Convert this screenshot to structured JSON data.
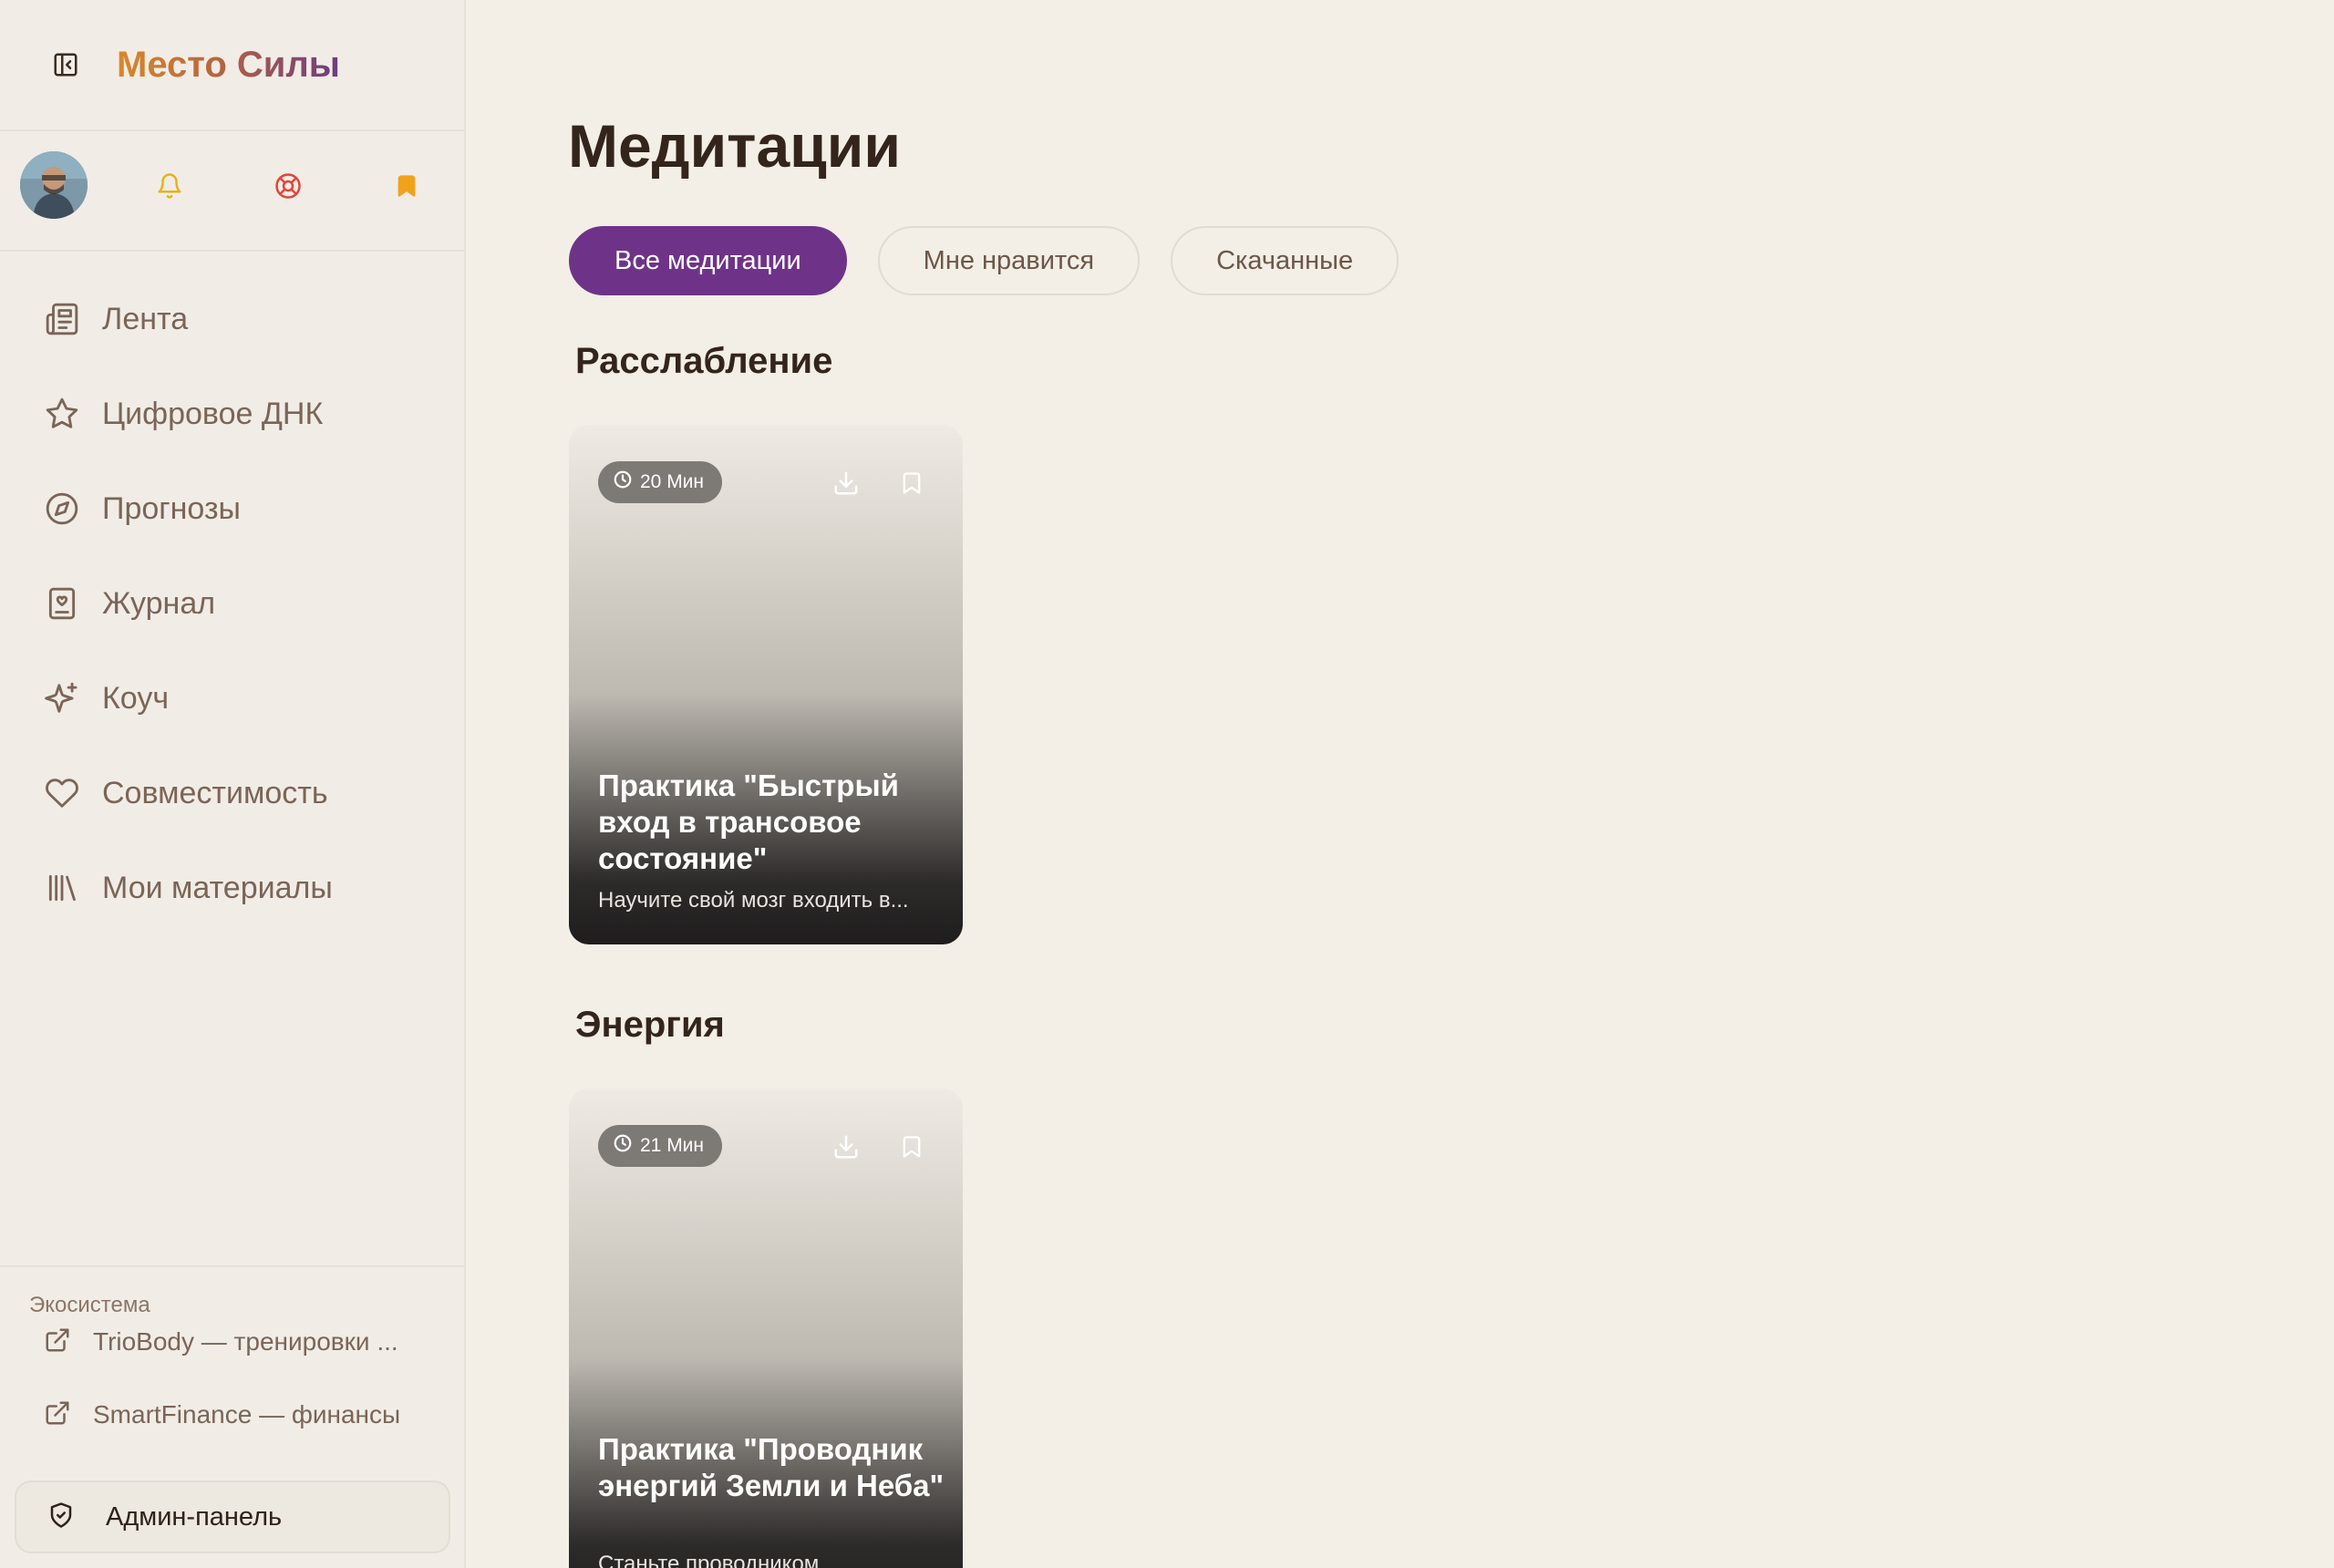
{
  "app": {
    "brand": "Место Силы"
  },
  "sidebar": {
    "nav": [
      {
        "label": "Лента",
        "icon": "newspaper-icon"
      },
      {
        "label": "Цифровое ДНК",
        "icon": "star-icon"
      },
      {
        "label": "Прогнозы",
        "icon": "compass-icon"
      },
      {
        "label": "Журнал",
        "icon": "journal-icon"
      },
      {
        "label": "Коуч",
        "icon": "sparkles-icon"
      },
      {
        "label": "Совместимость",
        "icon": "heart-icon"
      },
      {
        "label": "Мои материалы",
        "icon": "library-icon"
      }
    ],
    "ecosystem_title": "Экосистема",
    "ecosystem_links": [
      {
        "label": "TrioBody — тренировки ...",
        "icon": "external-link-icon"
      },
      {
        "label": "SmartFinance — финансы",
        "icon": "external-link-icon"
      }
    ],
    "admin_label": "Админ-панель",
    "colors": {
      "bell": "#e8b21c",
      "lifebuoy": "#e0453c",
      "bookmark": "#f0a21a"
    }
  },
  "main": {
    "title": "Медитации",
    "tabs": [
      {
        "label": "Все медитации",
        "active": true
      },
      {
        "label": "Мне нравится",
        "active": false
      },
      {
        "label": "Скачанные",
        "active": false
      }
    ],
    "sections": [
      {
        "title": "Расслабление",
        "cards": [
          {
            "duration": "20 Мин",
            "title": "Практика \"Быстрый вход в трансовое состояние\"",
            "description": "Научите свой мозг входить в..."
          }
        ]
      },
      {
        "title": "Энергия",
        "cards": [
          {
            "duration": "21 Мин",
            "title": "Практика \"Проводник энергий Земли и Неба\"",
            "description": "Станьте проводником"
          }
        ]
      }
    ],
    "accent_color": "#6e3389"
  }
}
